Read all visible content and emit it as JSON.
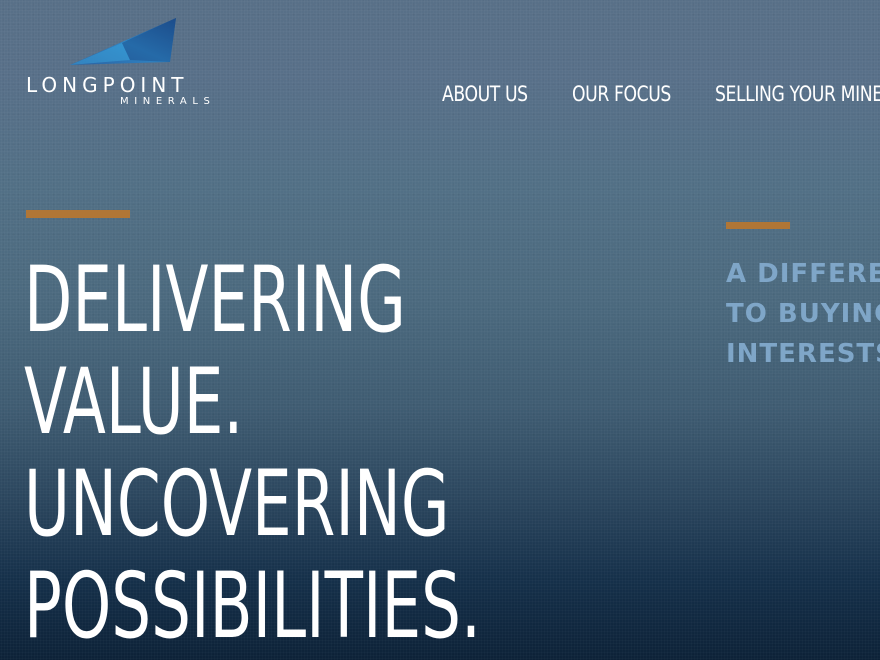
{
  "brand": {
    "name": "LONGPOINT",
    "sub": "MINERALS",
    "logo_icon": "angled-wing-logo-icon"
  },
  "nav": {
    "items": [
      {
        "label": "ABOUT US"
      },
      {
        "label": "OUR FOCUS"
      },
      {
        "label": "SELLING YOUR MINE"
      }
    ]
  },
  "hero": {
    "lines": [
      "DELIVERING",
      "VALUE.",
      "UNCOVERING",
      "POSSIBILITIES."
    ]
  },
  "tagline": {
    "lines": [
      "A DIFFERE",
      "TO BUYING",
      "INTERESTS"
    ]
  },
  "colors": {
    "accent": "#b07636",
    "tagline": "#7fa6c8",
    "background_top": "#587088",
    "background_bottom": "#0d2238"
  }
}
